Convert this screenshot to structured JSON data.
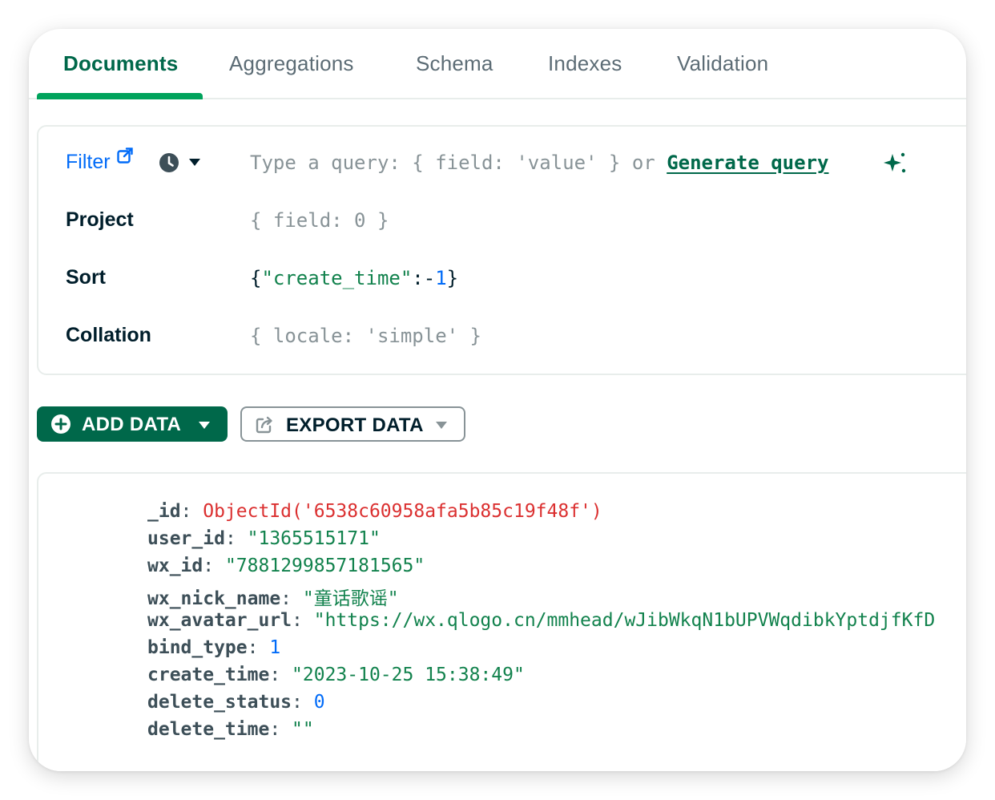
{
  "tabs": [
    {
      "label": "Documents",
      "active": true
    },
    {
      "label": "Aggregations",
      "active": false
    },
    {
      "label": "Schema",
      "active": false
    },
    {
      "label": "Indexes",
      "active": false
    },
    {
      "label": "Validation",
      "active": false
    }
  ],
  "query": {
    "filter_label": "Filter",
    "filter_placeholder": "Type a query: { field: 'value' } or",
    "generate_link": "Generate query",
    "project_label": "Project",
    "project_placeholder": "{ field: 0 }",
    "sort_label": "Sort",
    "sort_open": "{",
    "sort_key": "\"create_time\"",
    "sort_sep": ":-",
    "sort_num": "1",
    "sort_close": "}",
    "collation_label": "Collation",
    "collation_placeholder": "{ locale: 'simple' }"
  },
  "actions": {
    "add_data": "ADD DATA",
    "export_data": "EXPORT DATA"
  },
  "document": {
    "fields": [
      {
        "key": "_id",
        "value": "ObjectId('6538c60958afa5b85c19f48f')",
        "kind": "oid"
      },
      {
        "key": "user_id",
        "value": "\"1365515171\"",
        "kind": "str"
      },
      {
        "key": "wx_id",
        "value": "\"7881299857181565\"",
        "kind": "str"
      },
      {
        "key": "wx_nick_name",
        "value": "\"童话歌谣\"",
        "kind": "str"
      },
      {
        "key": "wx_avatar_url",
        "value": "\"https://wx.qlogo.cn/mmhead/wJibWkqN1bUPVWqdibkYptdjfKfD",
        "kind": "str"
      },
      {
        "key": "bind_type",
        "value": "1",
        "kind": "num"
      },
      {
        "key": "create_time",
        "value": "\"2023-10-25 15:38:49\"",
        "kind": "str"
      },
      {
        "key": "delete_status",
        "value": "0",
        "kind": "num"
      },
      {
        "key": "delete_time",
        "value": "\"\"",
        "kind": "str"
      }
    ]
  },
  "colors": {
    "accent_green": "#00684a",
    "tab_underline": "#00a35c",
    "link_blue": "#016bf8",
    "oid_red": "#db3030",
    "string_green": "#12824d"
  },
  "icons": [
    "external-link-icon",
    "clock-icon",
    "sparkle-icon",
    "plus-circle-icon",
    "export-icon",
    "caret-down-icon"
  ]
}
